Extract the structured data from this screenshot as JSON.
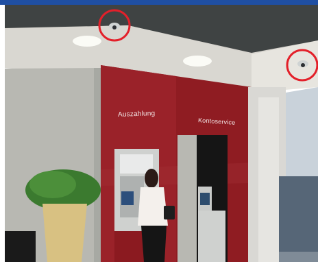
{
  "image": {
    "signage": {
      "auszahlung": "Auszahlung",
      "kontoservice": "Kontoservice"
    },
    "highlights": [
      {
        "name": "ceiling-camera-left",
        "color": "#e3202a"
      },
      {
        "name": "ceiling-camera-right",
        "color": "#e3202a"
      }
    ],
    "colors": {
      "top_bar": "#1f4fa3",
      "red_wall": "#8f1c22",
      "ceiling": "#3f4343",
      "highlight": "#e3202a"
    }
  }
}
